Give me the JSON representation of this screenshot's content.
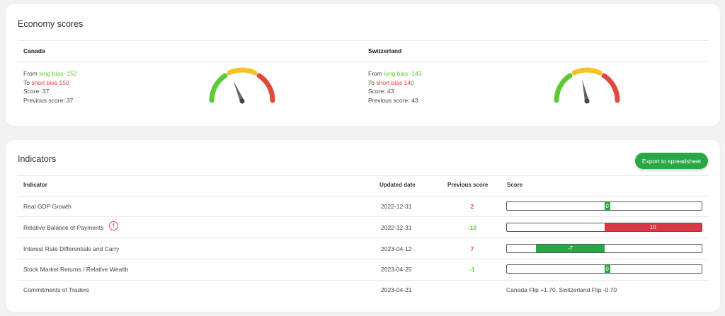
{
  "economy": {
    "title": "Economy scores",
    "countries": [
      {
        "name": "Canada",
        "from_prefix": "From ",
        "from_bias": "long bias -152",
        "to_prefix": "To ",
        "to_bias": "short bias 150",
        "score": "Score: 37",
        "previous": "Previous score: 37",
        "score_value": 37
      },
      {
        "name": "Switzerland",
        "from_prefix": "From ",
        "from_bias": "long bias -143",
        "to_prefix": "To ",
        "to_bias": "short bias 140",
        "score": "Score: 43",
        "previous": "Previous score: 43",
        "score_value": 43
      }
    ]
  },
  "indicators": {
    "title": "Indicators",
    "export_label": "Export to spreadsheet",
    "headers": {
      "indicator": "Indicator",
      "updated": "Updated date",
      "previous": "Previous score",
      "score": "Score"
    },
    "rows": [
      {
        "name": "Real GDP Growth",
        "date": "2022-12-31",
        "previous": "2",
        "previous_color": "#e04a3c",
        "score_label": "0",
        "score_value": 0,
        "score_color": "#28a745",
        "warning": false
      },
      {
        "name": "Relative Balance of Payments",
        "date": "2022-12-31",
        "previous": "-10",
        "previous_color": "#5cc936",
        "score_label": "10",
        "score_value": 10,
        "score_color": "#dc3545",
        "warning": true,
        "warning_icon": "exclamation-circle-icon"
      },
      {
        "name": "Interest Rate Differentials and Carry",
        "date": "2023-04-12",
        "previous": "7",
        "previous_color": "#e04a3c",
        "score_label": "-7",
        "score_value": -7,
        "score_color": "#28a745",
        "warning": false
      },
      {
        "name": "Stock Market Returns / Relative Wealth",
        "date": "2023-04-25",
        "previous": "-1",
        "previous_color": "#5cc936",
        "score_label": "0",
        "score_value": 0,
        "score_color": "#28a745",
        "warning": false
      },
      {
        "name": "Commitments of Traders",
        "date": "2023-04-21",
        "score_text": "Canada Flip +1.70, Switzerland Flip -0.70"
      }
    ]
  }
}
